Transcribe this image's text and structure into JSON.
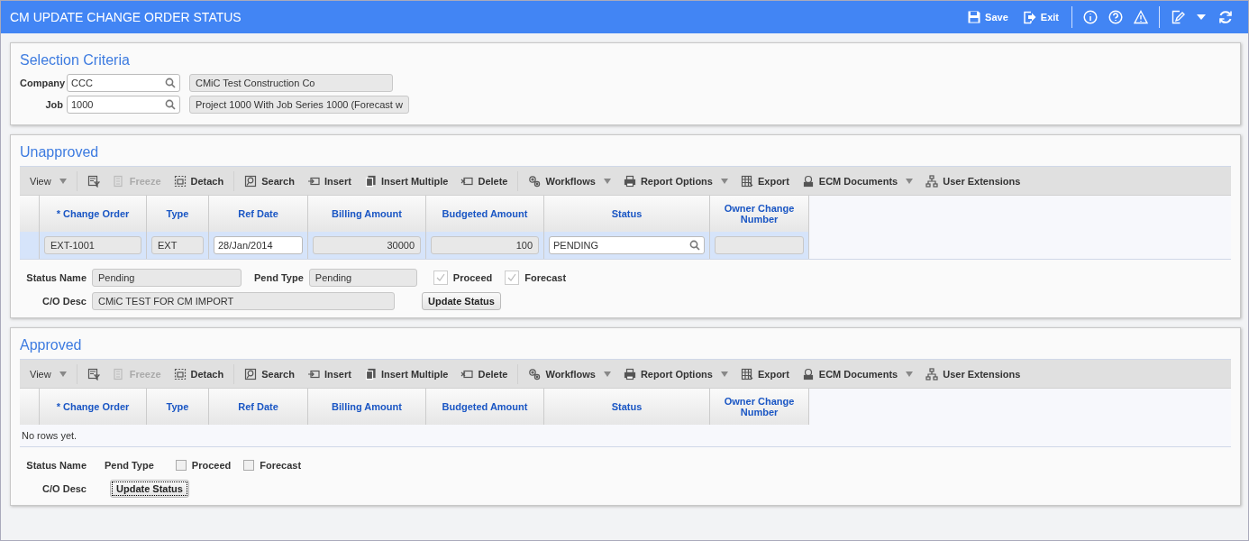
{
  "header": {
    "title": "CM UPDATE CHANGE ORDER STATUS",
    "actions": [
      {
        "kind": "save",
        "label": "Save"
      },
      {
        "kind": "exit",
        "label": "Exit"
      }
    ]
  },
  "selection": {
    "title": "Selection Criteria",
    "fields": [
      {
        "label": "Company",
        "value": "CCC",
        "description": "CMiC Test Construction Co"
      },
      {
        "label": "Job",
        "value": "1000",
        "description": "Project 1000 With Job Series 1000 (Forecast w"
      }
    ]
  },
  "sections": [
    {
      "title": "Unapproved",
      "toolbar": [
        {
          "kind": "view",
          "label": "View",
          "dropdown": true,
          "disabled": false
        },
        {
          "kind": "filter",
          "dropdown": false,
          "disabled": false
        },
        {
          "kind": "freeze",
          "label": "Freeze",
          "dropdown": false,
          "disabled": true
        },
        {
          "kind": "detach",
          "label": "Detach",
          "dropdown": false,
          "disabled": false
        },
        {
          "kind": "search",
          "label": "Search",
          "dropdown": false,
          "disabled": false
        },
        {
          "kind": "insert",
          "label": "Insert",
          "dropdown": false,
          "disabled": false
        },
        {
          "kind": "insert_multiple",
          "label": "Insert Multiple",
          "dropdown": false,
          "disabled": false
        },
        {
          "kind": "delete",
          "label": "Delete",
          "dropdown": false,
          "disabled": false
        },
        {
          "kind": "workflows",
          "label": "Workflows",
          "dropdown": true,
          "disabled": false
        },
        {
          "kind": "report",
          "label": "Report Options",
          "dropdown": true,
          "disabled": false
        },
        {
          "kind": "export",
          "label": "Export",
          "dropdown": false,
          "disabled": false
        },
        {
          "kind": "ecm",
          "label": "ECM Documents",
          "dropdown": true,
          "disabled": false
        },
        {
          "kind": "extensions",
          "label": "User Extensions",
          "dropdown": false,
          "disabled": false
        }
      ],
      "columns": [
        "* Change Order",
        "Type",
        "Ref Date",
        "Billing Amount",
        "Budgeted Amount",
        "Status",
        "Owner Change Number"
      ],
      "rows": [
        {
          "selected": true,
          "cells": [
            {
              "kind": "readonly",
              "value": "EXT-1001"
            },
            {
              "kind": "readonly",
              "value": "EXT"
            },
            {
              "kind": "input",
              "value": "28/Jan/2014"
            },
            {
              "kind": "number",
              "value": "30000"
            },
            {
              "kind": "number",
              "value": "100"
            },
            {
              "kind": "lookup",
              "value": "PENDING"
            },
            {
              "kind": "readonly"
            }
          ]
        }
      ],
      "details": {
        "status_name": {
          "label": "Status Name",
          "value": "Pending"
        },
        "pend_type": {
          "label": "Pend Type",
          "value": "Pending"
        },
        "checkboxes": [
          {
            "label": "Proceed",
            "checked": true
          },
          {
            "label": "Forecast",
            "checked": true
          }
        ],
        "co_desc": {
          "label": "C/O Desc",
          "value": "CMiC TEST FOR CM IMPORT"
        },
        "button": {
          "label": "Update Status",
          "focused": false
        }
      }
    },
    {
      "title": "Approved",
      "toolbar": [
        {
          "kind": "view",
          "label": "View",
          "dropdown": true,
          "disabled": false
        },
        {
          "kind": "filter",
          "dropdown": false,
          "disabled": false
        },
        {
          "kind": "freeze",
          "label": "Freeze",
          "dropdown": false,
          "disabled": true
        },
        {
          "kind": "detach",
          "label": "Detach",
          "dropdown": false,
          "disabled": false
        },
        {
          "kind": "search",
          "label": "Search",
          "dropdown": false,
          "disabled": false
        },
        {
          "kind": "insert",
          "label": "Insert",
          "dropdown": false,
          "disabled": false
        },
        {
          "kind": "insert_multiple",
          "label": "Insert Multiple",
          "dropdown": false,
          "disabled": false
        },
        {
          "kind": "delete",
          "label": "Delete",
          "dropdown": false,
          "disabled": false
        },
        {
          "kind": "workflows",
          "label": "Workflows",
          "dropdown": true,
          "disabled": false
        },
        {
          "kind": "report",
          "label": "Report Options",
          "dropdown": true,
          "disabled": false
        },
        {
          "kind": "export",
          "label": "Export",
          "dropdown": false,
          "disabled": false
        },
        {
          "kind": "ecm",
          "label": "ECM Documents",
          "dropdown": true,
          "disabled": false
        },
        {
          "kind": "extensions",
          "label": "User Extensions",
          "dropdown": false,
          "disabled": false
        }
      ],
      "columns": [
        "* Change Order",
        "Type",
        "Ref Date",
        "Billing Amount",
        "Budgeted Amount",
        "Status",
        "Owner Change Number"
      ],
      "empty_text": "No rows yet.",
      "details": {
        "status_name": {
          "label": "Status Name"
        },
        "pend_type": {
          "label": "Pend Type"
        },
        "checkboxes": [
          {
            "label": "Proceed",
            "checked": false
          },
          {
            "label": "Forecast",
            "checked": false
          }
        ],
        "co_desc": {
          "label": "C/O Desc"
        },
        "button": {
          "label": "Update Status",
          "focused": true
        }
      }
    }
  ]
}
